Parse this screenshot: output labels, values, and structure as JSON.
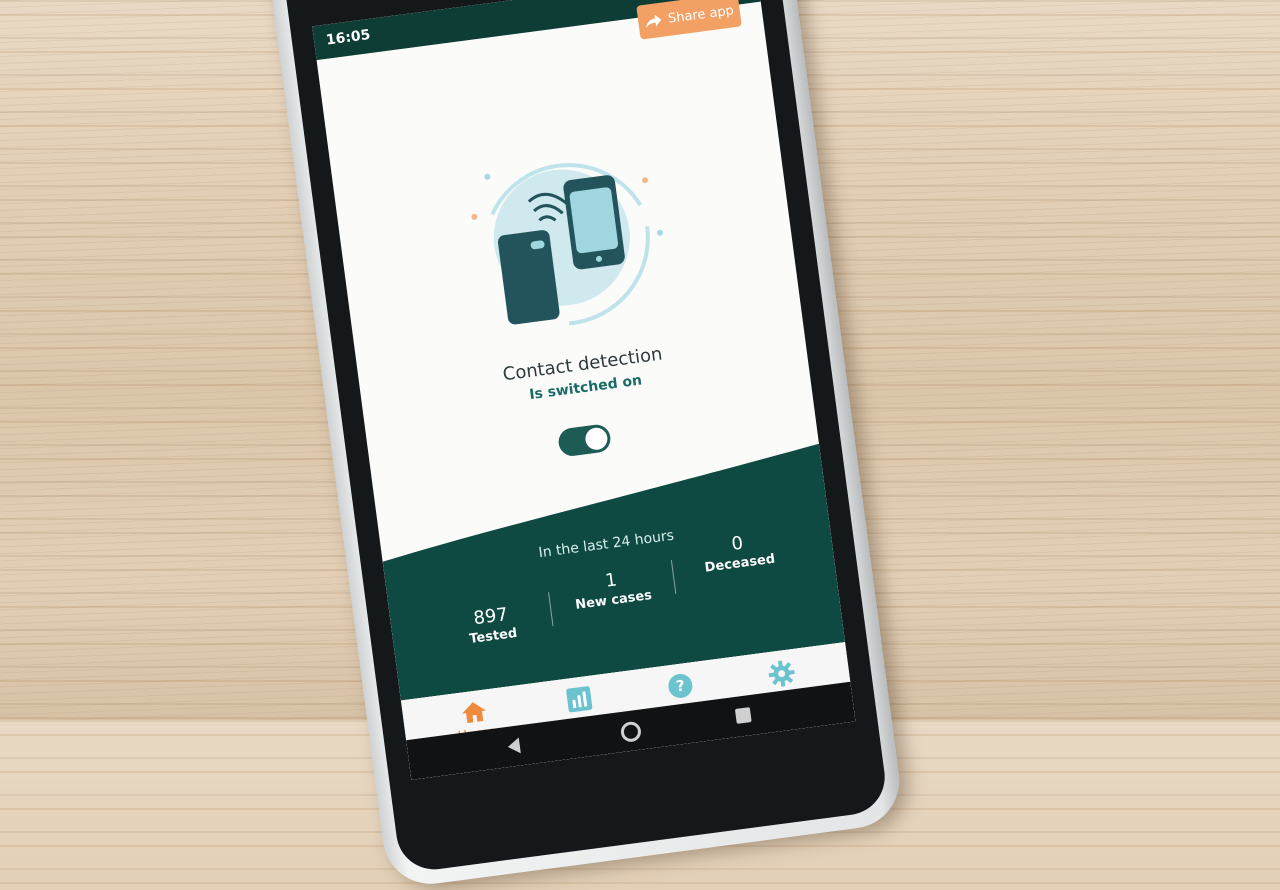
{
  "status_bar": {
    "time": "16:05"
  },
  "header": {
    "share_label": "Share app"
  },
  "contact_detection": {
    "title": "Contact detection",
    "status": "Is switched on",
    "toggle_on": true
  },
  "stats": {
    "header": "In the last 24 hours",
    "items": [
      {
        "value": "897",
        "label": "Tested"
      },
      {
        "value": "1",
        "label": "New cases"
      },
      {
        "value": "0",
        "label": "Deceased"
      }
    ]
  },
  "nav": {
    "items": [
      {
        "label": "Home",
        "icon": "home-icon",
        "active": true
      },
      {
        "label": "",
        "icon": "chart-icon",
        "active": false
      },
      {
        "label": "",
        "icon": "help-icon",
        "active": false
      },
      {
        "label": "",
        "icon": "gear-icon",
        "active": false
      }
    ]
  },
  "colors": {
    "primary": "#1c5c54",
    "accent": "#f2a064",
    "dark": "#0d3d35",
    "light_teal": "#9fd6df"
  }
}
